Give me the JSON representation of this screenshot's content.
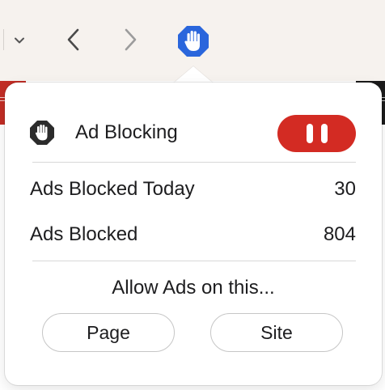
{
  "toolbar": {
    "icons": {
      "collapse": "chevron-down-icon",
      "back": "chevron-left-icon",
      "forward": "chevron-right-icon",
      "extension": "hand-stop-icon"
    },
    "colors": {
      "extension_icon": "#2a66dc",
      "arrow_active": "#4a4a4a",
      "arrow_disabled": "#9c9c9c"
    }
  },
  "popover": {
    "header": {
      "icon": "hand-stop-octagon-icon",
      "title": "Ad Blocking",
      "pause_icon": "pause-icon",
      "pause_color": "#d32b23"
    },
    "stats": [
      {
        "label": "Ads Blocked Today",
        "value": "30"
      },
      {
        "label": "Ads Blocked",
        "value": "804"
      }
    ],
    "allow_label": "Allow Ads on this...",
    "buttons": {
      "page": "Page",
      "site": "Site"
    }
  }
}
